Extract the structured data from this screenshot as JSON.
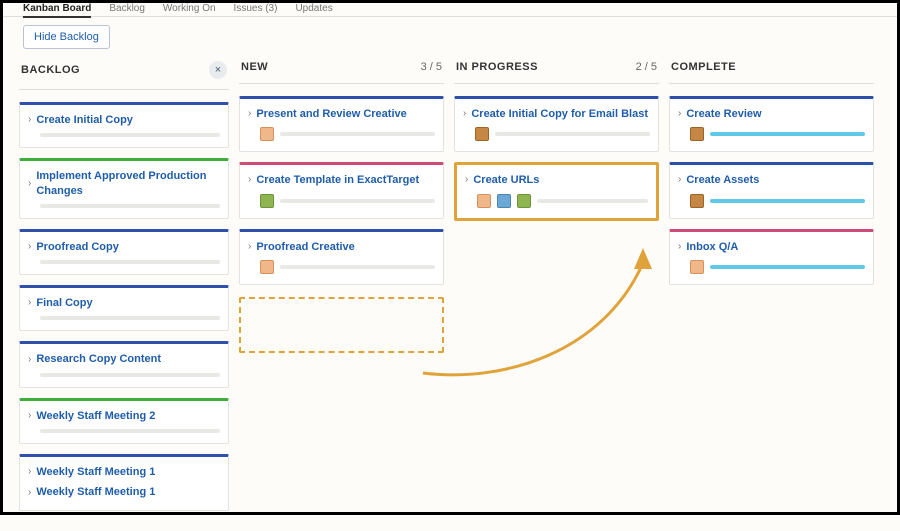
{
  "nav": {
    "tabs": [
      {
        "label": "Kanban Board",
        "active": true
      },
      {
        "label": "Backlog"
      },
      {
        "label": "Working On"
      },
      {
        "label": "Issues (3)"
      },
      {
        "label": "Updates"
      }
    ]
  },
  "toolbar": {
    "hide_backlog_label": "Hide Backlog"
  },
  "columns": {
    "backlog": {
      "title": "BACKLOG",
      "cards": [
        {
          "title": "Create Initial Copy",
          "accent": "blue"
        },
        {
          "title": "Implement Approved Production Changes",
          "accent": "green"
        },
        {
          "title": "Proofread Copy",
          "accent": "blue"
        },
        {
          "title": "Final Copy",
          "accent": "blue"
        },
        {
          "title": "Research Copy Content",
          "accent": "blue"
        },
        {
          "title": "Weekly Staff Meeting 2",
          "accent": "green"
        },
        {
          "titles": [
            "Weekly Staff Meeting 1",
            "Weekly Staff Meeting 1"
          ],
          "accent": "blue"
        }
      ]
    },
    "new": {
      "title": "NEW",
      "count": "3 / 5",
      "cards": [
        {
          "title": "Present and Review Creative",
          "accent": "blue",
          "avatars": [
            "a4"
          ]
        },
        {
          "title": "Create Template in ExactTarget",
          "accent": "pink",
          "avatars": [
            "a2"
          ]
        },
        {
          "title": "Proofread Creative",
          "accent": "blue",
          "avatars": [
            "a4"
          ]
        }
      ]
    },
    "in_progress": {
      "title": "IN PROGRESS",
      "count": "2 / 5",
      "cards": [
        {
          "title": "Create Initial Copy for Email Blast",
          "accent": "blue",
          "avatars": [
            "a3"
          ]
        },
        {
          "title": "Create URLs",
          "accent": "blue",
          "avatars": [
            "a4",
            "a5",
            "a2"
          ],
          "highlight": true
        }
      ]
    },
    "complete": {
      "title": "COMPLETE",
      "cards": [
        {
          "title": "Create Review",
          "accent": "blue",
          "avatars": [
            "a3"
          ],
          "progress_color": "blue"
        },
        {
          "title": "Create Assets",
          "accent": "blue",
          "avatars": [
            "a3"
          ],
          "progress_color": "blue"
        },
        {
          "title": "Inbox Q/A",
          "accent": "pink",
          "avatars": [
            "a4"
          ],
          "progress_color": "blue"
        }
      ]
    }
  },
  "annotation": {
    "arrow_color": "#e0a33a"
  }
}
